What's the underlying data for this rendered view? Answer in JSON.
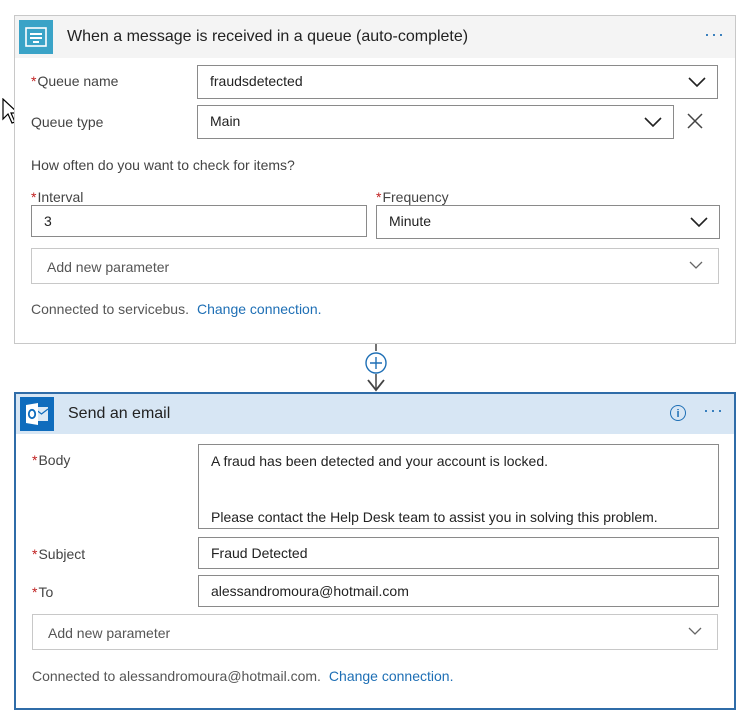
{
  "trigger": {
    "title": "When a message is received in a queue (auto-complete)",
    "more_label": "···",
    "icon": "servicebus-icon",
    "queue_name_label": "Queue name",
    "queue_name_value": "fraudsdetected",
    "queue_type_label": "Queue type",
    "queue_type_value": "Main",
    "check_question": "How often do you want to check for items?",
    "interval_label": "Interval",
    "interval_value": "3",
    "frequency_label": "Frequency",
    "frequency_value": "Minute",
    "add_param_label": "Add new parameter",
    "connected_text": "Connected to servicebus.",
    "change_connection": "Change connection."
  },
  "connector": {
    "insert_icon": "plus-circle-icon",
    "arrow_icon": "arrow-down-icon"
  },
  "action": {
    "title": "Send an email",
    "icon": "outlook-icon",
    "info_label": "i",
    "more_label": "···",
    "body_label": "Body",
    "body_line1": "A fraud has been detected and your account is locked.",
    "body_line2": "Please contact the Help Desk team to assist you in solving this problem.",
    "subject_label": "Subject",
    "subject_value": "Fraud Detected",
    "to_label": "To",
    "to_value": "alessandromoura@hotmail.com",
    "add_param_label": "Add new parameter",
    "connected_text": "Connected to alessandromoura@hotmail.com.",
    "change_connection": "Change connection."
  },
  "required_mark": "*",
  "colors": {
    "accent": "#1e6fb5",
    "required": "#c02020",
    "servicebus": "#3aa3c7",
    "outlook": "#0f6cbd"
  }
}
